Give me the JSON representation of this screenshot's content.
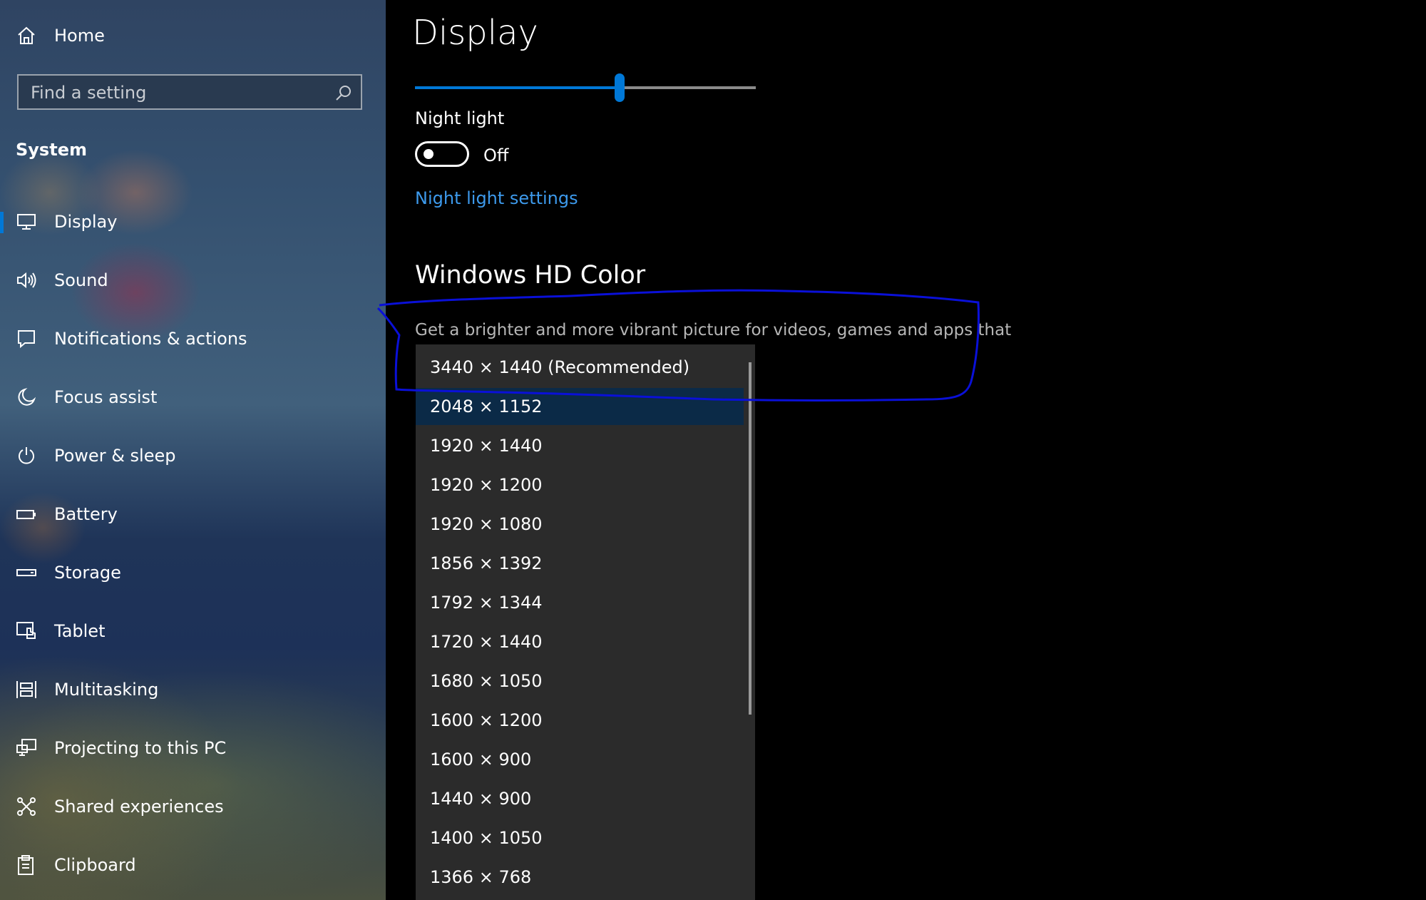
{
  "sidebar": {
    "home_label": "Home",
    "search_placeholder": "Find a setting",
    "section_title": "System",
    "items": [
      {
        "label": "Display",
        "icon": "monitor-icon"
      },
      {
        "label": "Sound",
        "icon": "speaker-icon"
      },
      {
        "label": "Notifications & actions",
        "icon": "notification-icon"
      },
      {
        "label": "Focus assist",
        "icon": "moon-icon"
      },
      {
        "label": "Power & sleep",
        "icon": "power-icon"
      },
      {
        "label": "Battery",
        "icon": "battery-icon"
      },
      {
        "label": "Storage",
        "icon": "storage-icon"
      },
      {
        "label": "Tablet",
        "icon": "tablet-icon"
      },
      {
        "label": "Multitasking",
        "icon": "multitasking-icon"
      },
      {
        "label": "Projecting to this PC",
        "icon": "projecting-icon"
      },
      {
        "label": "Shared experiences",
        "icon": "shared-experiences-icon"
      },
      {
        "label": "Clipboard",
        "icon": "clipboard-icon"
      }
    ],
    "active_item": "Display"
  },
  "main": {
    "title": "Display",
    "brightness_level": 0.6,
    "night_light": {
      "label": "Night light",
      "state": "Off",
      "link": "Night light settings"
    },
    "hd_color": {
      "heading": "Windows HD Color",
      "description": "Get a brighter and more vibrant picture for videos, games and apps that"
    },
    "resolution_dropdown": {
      "selected": "2048 × 1152",
      "options": [
        "3440 × 1440 (Recommended)",
        "2048 × 1152",
        "1920 × 1440",
        "1920 × 1200",
        "1920 × 1080",
        "1856 × 1392",
        "1792 × 1344",
        "1720 × 1440",
        "1680 × 1050",
        "1600 × 1200",
        "1600 × 900",
        "1440 × 900",
        "1400 × 1050",
        "1366 × 768"
      ]
    }
  },
  "colors": {
    "accent": "#0078d7",
    "link": "#3d9aec",
    "annotation": "#0a10d8",
    "dropdown_bg": "#2b2b2b",
    "selected_bg": "#0b2a47"
  }
}
